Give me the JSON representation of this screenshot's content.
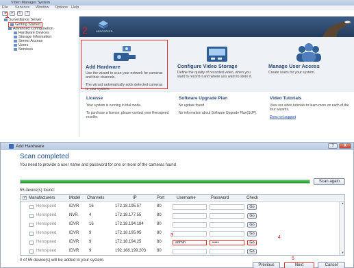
{
  "main_window": {
    "title": "Video Manager System",
    "menu": [
      "File",
      "Services",
      "Window",
      "Options",
      "Help"
    ],
    "tree": [
      {
        "label": "Surveillance Server"
      },
      {
        "label": "Getting Started"
      },
      {
        "label": "Advanced Configuration"
      },
      {
        "label": "Hardware Devices"
      },
      {
        "label": "Storage Information"
      },
      {
        "label": "Server Access"
      },
      {
        "label": "Users"
      },
      {
        "label": "Services"
      }
    ],
    "banner_brand": "HEROSPEED",
    "cards": [
      {
        "title": "Add Hardware",
        "desc": "Use the wizard to scan your network for cameras and their channels.",
        "desc2": "The wizard automatically adds detected cameras to your system."
      },
      {
        "title": "Configure Video Storage",
        "desc": "Define the quality of recorded video, when you want to record it and where you want to store it."
      },
      {
        "title": "Manage User Access",
        "desc": "Create users for your system."
      }
    ],
    "lower_cards": [
      {
        "title": "License",
        "desc": "Your system is running in trial mode.",
        "desc2": "To purchase a license, please contact your Herospeed reseller.",
        "link": ""
      },
      {
        "title": "Software Upgrade Plan",
        "desc": "No update found",
        "desc2": "No information about Software Upgrade Plan(SUP).",
        "link": ""
      },
      {
        "title": "Video Tutorials",
        "desc": "View our video tutorials to learn more on each of the four wizards.",
        "desc2": "",
        "link": "Does not support"
      }
    ]
  },
  "annotations": {
    "one": "1",
    "two": "2",
    "three": "3",
    "four": "4",
    "five": "5"
  },
  "dialog": {
    "title": "Add Hardware",
    "heading": "Scan completed",
    "instruction": "You need to provide a user name and password for one or more of the cameras found",
    "progress": 1.0,
    "scan_again_label": "Scan again",
    "found_count": "55 device(s) found:",
    "columns": {
      "manufacturers": "Manufacturers",
      "model": "Model",
      "channels": "Channels",
      "ip": "IP",
      "port": "Port",
      "username": "Username",
      "password": "Password",
      "check": "Check"
    },
    "rows": [
      {
        "manufacturer": "Herospeed",
        "model": "IDVR",
        "channels": "16",
        "ip": "172.18.195.57",
        "port": "80",
        "username": "",
        "password": "",
        "check": "Go"
      },
      {
        "manufacturer": "Herospeed",
        "model": "NVR",
        "channels": "4",
        "ip": "172.18.177.55",
        "port": "80",
        "username": "",
        "password": "",
        "check": "Go"
      },
      {
        "manufacturer": "Herospeed",
        "model": "IDVR",
        "channels": "16",
        "ip": "172.18.194.184",
        "port": "80",
        "username": "",
        "password": "",
        "check": "Go"
      },
      {
        "manufacturer": "Herospeed",
        "model": "IDVR",
        "channels": "9",
        "ip": "172.18.195.95",
        "port": "80",
        "username": "",
        "password": "",
        "check": "Go"
      },
      {
        "manufacturer": "Herospeed",
        "model": "IDVR",
        "channels": "9",
        "ip": "172.18.194.25",
        "port": "80",
        "username": "admin",
        "password": "•••••",
        "check": "Go"
      },
      {
        "manufacturer": "Herospeed",
        "model": "IDVR",
        "channels": "9",
        "ip": "192.168.199.203",
        "port": "80",
        "username": "",
        "password": "",
        "check": "Go"
      }
    ],
    "footer_note": "0 of 55 device(s) will be added to your system.",
    "buttons": {
      "previous": "Previous",
      "next": "Next",
      "cancel": "Cancel"
    },
    "window_buttons": {
      "help": "?",
      "close": "X"
    }
  }
}
